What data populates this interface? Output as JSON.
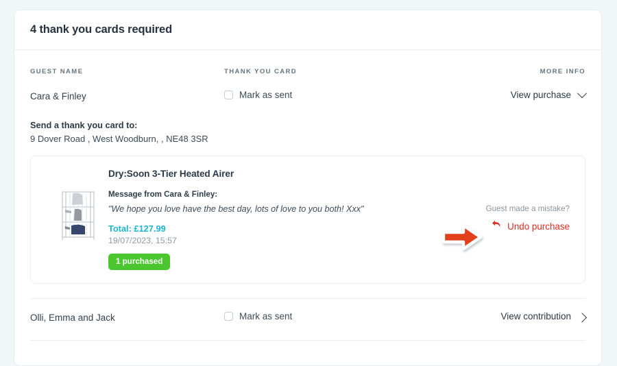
{
  "header": {
    "title": "4 thank you cards required"
  },
  "columns": {
    "guest_name": "GUEST NAME",
    "thank_you_card": "THANK YOU CARD",
    "more_info": "MORE INFO"
  },
  "rows": [
    {
      "guest_name": "Cara & Finley",
      "mark_as_sent_label": "Mark as sent",
      "mark_as_sent_checked": false,
      "action_label": "View purchase",
      "action_icon": "chevron-down-icon",
      "address": {
        "title": "Send a thank you card to:",
        "line": "9 Dover Road , West Woodburn, , NE48 3SR"
      },
      "purchase": {
        "image_alt": "dry-soon-3-tier-heated-airer-thumbnail",
        "product_title": "Dry:Soon 3-Tier Heated Airer",
        "message_from_label": "Message from Cara & Finley:",
        "message": "\"We hope you love have the best day, lots of love to you both! Xxx\"",
        "total": "Total: £127.99",
        "date": "19/07/2023, 15:57",
        "badge": "1 purchased",
        "mistake_prompt": "Guest made a mistake?",
        "undo_label": "Undo purchase",
        "undo_icon": "undo-arrow-icon"
      }
    },
    {
      "guest_name": "Olli, Emma and Jack",
      "mark_as_sent_label": "Mark as sent",
      "mark_as_sent_checked": false,
      "action_label": "View contribution",
      "action_icon": "chevron-right-icon"
    }
  ],
  "annotation": {
    "type": "arrow-right-annotation",
    "points_to": "Undo purchase",
    "color": "#e2401c"
  },
  "colors": {
    "page_background": "#f1f6f9",
    "card_background": "#ffffff",
    "accent_total": "#19b6d3",
    "badge_green": "#4ac62f",
    "undo_red": "#e02b20",
    "annotation_orange": "#e2401c",
    "text_primary": "#2b3947",
    "text_muted": "#8f9aa3"
  }
}
